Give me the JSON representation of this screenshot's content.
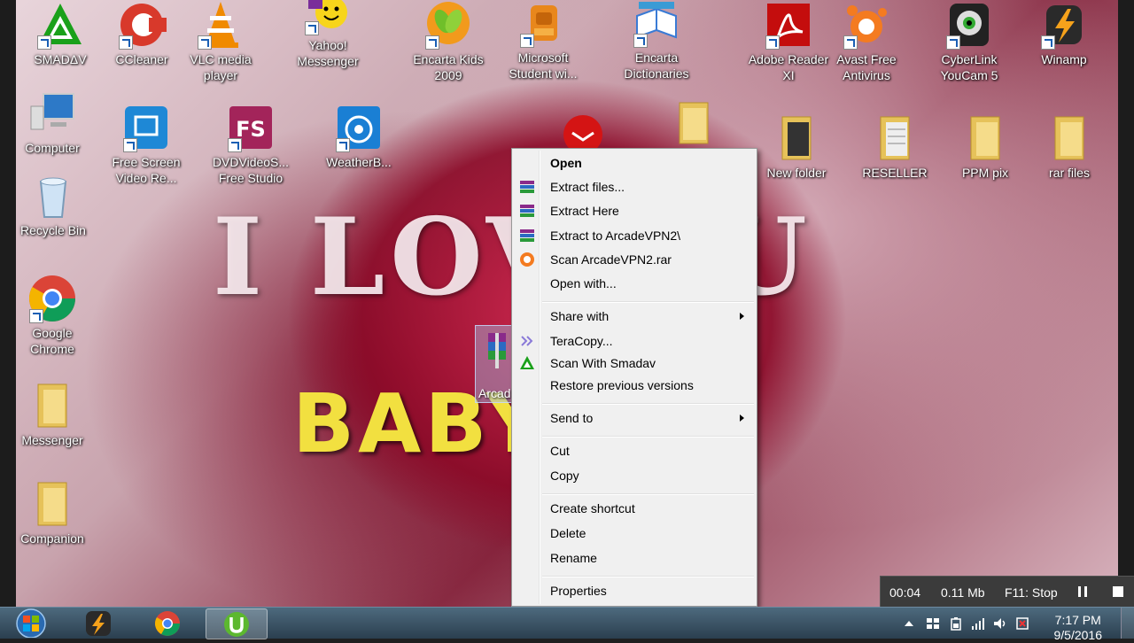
{
  "desktop_icons": [
    {
      "label": "SMADΔV",
      "icon": "smadav-icon"
    },
    {
      "label": "CCleaner",
      "icon": "ccleaner-icon"
    },
    {
      "label": "VLC media player",
      "icon": "vlc-icon"
    },
    {
      "label": "Yahoo! Messenger",
      "icon": "yahoo-messenger-icon"
    },
    {
      "label": "Encarta Kids 2009",
      "icon": "encarta-kids-icon"
    },
    {
      "label": "Microsoft Student wi...",
      "icon": "microsoft-student-icon"
    },
    {
      "label": "Encarta Dictionaries",
      "icon": "encarta-dictionaries-icon"
    },
    {
      "label": "Adobe Reader XI",
      "icon": "adobe-reader-icon"
    },
    {
      "label": "Avast Free Antivirus",
      "icon": "avast-icon"
    },
    {
      "label": "CyberLink YouCam 5",
      "icon": "youcam-icon"
    },
    {
      "label": "Winamp",
      "icon": "winamp-icon"
    },
    {
      "label": "Computer",
      "icon": "computer-icon"
    },
    {
      "label": "Free Screen Video Re...",
      "icon": "screen-recorder-icon"
    },
    {
      "label": "DVDVideoS... Free Studio",
      "icon": "dvdvideosoft-icon"
    },
    {
      "label": "WeatherB...",
      "icon": "weather-icon"
    },
    {
      "label": "New folder",
      "icon": "folder-icon"
    },
    {
      "label": "RESELLER",
      "icon": "folder-icon"
    },
    {
      "label": "PPM pix",
      "icon": "folder-icon"
    },
    {
      "label": "rar files",
      "icon": "folder-icon"
    },
    {
      "label": "Recycle Bin",
      "icon": "recycle-bin-icon"
    },
    {
      "label": "Google Chrome",
      "icon": "chrome-icon"
    },
    {
      "label": "Messenger",
      "icon": "folder-icon"
    },
    {
      "label": "Companion",
      "icon": "folder-icon"
    },
    {
      "label": "Arcad",
      "icon": "winrar-archive-icon"
    }
  ],
  "wallpaper": {
    "line1": "I LOV  OU",
    "line2": "BABY      akn"
  },
  "context_menu": {
    "items": [
      {
        "label": "Open",
        "bold": true,
        "icon": ""
      },
      {
        "label": "Extract files...",
        "icon": "winrar-icon"
      },
      {
        "label": "Extract Here",
        "icon": "winrar-icon"
      },
      {
        "label": "Extract to ArcadeVPN2\\",
        "icon": "winrar-icon"
      },
      {
        "label": "Scan ArcadeVPN2.rar",
        "icon": "avast-icon"
      },
      {
        "label": "Open with...",
        "icon": ""
      },
      {
        "label": "Share with",
        "submenu": true
      },
      {
        "label": "TeraCopy...",
        "icon": "teracopy-icon"
      },
      {
        "label": "Scan With Smadav",
        "icon": "smadav-icon"
      },
      {
        "label": "Restore previous versions",
        "icon": ""
      },
      {
        "label": "Send to",
        "submenu": true
      },
      {
        "label": "Cut",
        "icon": ""
      },
      {
        "label": "Copy",
        "icon": ""
      },
      {
        "label": "Create shortcut",
        "icon": ""
      },
      {
        "label": "Delete",
        "icon": ""
      },
      {
        "label": "Rename",
        "icon": ""
      },
      {
        "label": "Properties",
        "icon": ""
      }
    ]
  },
  "recorder_bar": {
    "time": "00:04",
    "size": "0.11 Mb",
    "stop_hint": "F11: Stop"
  },
  "taskbar": {
    "buttons": [
      "start-button",
      "winamp",
      "chrome",
      "utorrent"
    ],
    "clock_time": "7:17 PM",
    "clock_date": "9/5/2016"
  },
  "colors": {
    "menu_bg": "#f0f0f0",
    "taskbar": "#2b3f4f",
    "wallpaper_heart": "#8a1030",
    "wallpaper_text_yellow": "#f2e040"
  }
}
